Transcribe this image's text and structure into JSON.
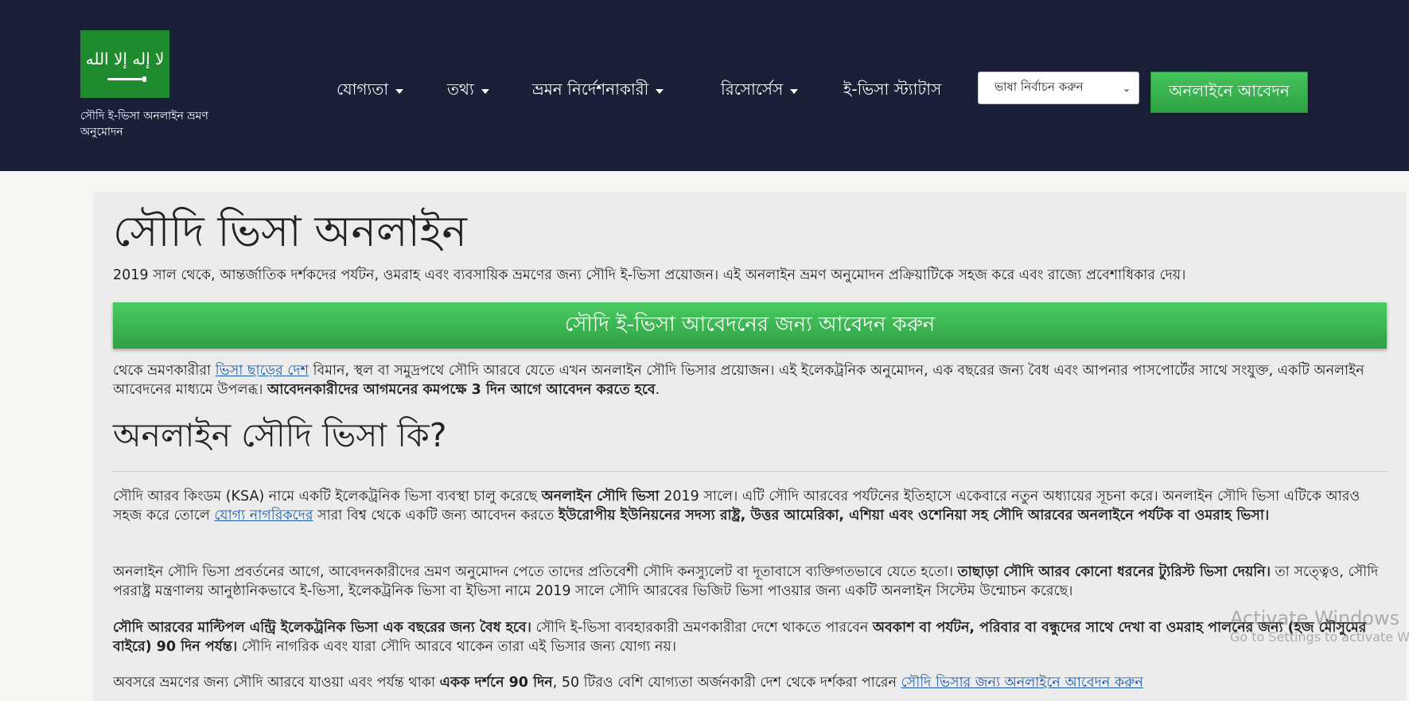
{
  "header": {
    "logo_caption": "সৌদি ই-ভিসা অনলাইন ভ্রমণ অনুমোদন",
    "flag_script": "لا إله إلا الله"
  },
  "nav": {
    "items": [
      {
        "label": "যোগ্যতা"
      },
      {
        "label": "তথ্য"
      },
      {
        "label": "ভ্রমন নির্দেশনাকারী"
      },
      {
        "label": "রিসোর্সেস"
      },
      {
        "label": "ই-ভিসা স্ট্যাটাস"
      }
    ],
    "language_select": "ভাষা নির্বাচন করুন",
    "apply_button": "অনলাইনে আবেদন"
  },
  "main": {
    "title": "সৌদি ভিসা অনলাইন",
    "intro": "2019 সাল থেকে, আন্তর্জাতিক দর্শকদের পর্যটন, ওমরাহ এবং ব্যবসায়িক ভ্রমণের জন্য সৌদি ই-ভিসা প্রয়োজন। এই অনলাইন ভ্রমণ অনুমোদন প্রক্রিয়াটিকে সহজ করে এবং রাজ্যে প্রবেশাধিকার দেয়।",
    "apply_big_button": "সৌদি ই-ভিসা আবেদনের জন্য আবেদন করুন",
    "p2": {
      "t1": "থেকে ভ্রমণকারীরা ",
      "link": "ভিসা ছাড়ের দেশ",
      "t2": " বিমান, স্থল বা সমুদ্রপথে সৌদি আরবে যেতে এখন অনলাইন সৌদি ভিসার প্রয়োজন। এই ইলেকট্রনিক অনুমোদন, এক বছরের জন্য বৈধ এবং আপনার পাসপোর্টের সাথে সংযুক্ত, একটি অনলাইন আবেদনের মাধ্যমে উপলব্ধ। ",
      "bold": "আবেদনকারীদের আগমনের কমপক্ষে 3 দিন আগে আবেদন করতে হবে",
      "t3": "."
    },
    "subtitle": "অনলাইন সৌদি ভিসা কি?",
    "p3": {
      "t1": "সৌদি আরব কিংডম (KSA) নামে একটি ইলেকট্রনিক ভিসা ব্যবস্থা চালু করেছে ",
      "b1": "অনলাইন সৌদি ভিসা",
      "t2": " 2019 সালে। এটি সৌদি আরবের পর্যটনের ইতিহাসে একেবারে নতুন অধ্যায়ের সূচনা করে। অনলাইন সৌদি ভিসা এটিকে আরও সহজ করে তোলে ",
      "link": "যোগ্য নাগরিকদের",
      "t3": " সারা বিশ্ব থেকে একটি জন্য আবেদন করতে ",
      "b2": "ইউরোপীয় ইউনিয়নের সদস্য রাষ্ট্র, উত্তর আমেরিকা, এশিয়া এবং ওশেনিয়া সহ সৌদি আরবের অনলাইনে পর্যটক বা ওমরাহ ভিসা।"
    },
    "p4": {
      "t1": "অনলাইন সৌদি ভিসা প্রবর্তনের আগে, আবেদনকারীদের ভ্রমণ অনুমোদন পেতে তাদের প্রতিবেশী সৌদি কনস্যুলেট বা দূতাবাসে ব্যক্তিগতভাবে যেতে হতো। ",
      "b1": "তাছাড়া সৌদি আরব কোনো ধরনের ট্যুরিস্ট ভিসা দেয়নি।",
      "t2": " তা সত্ত্বেও, সৌদি পররাষ্ট্র মন্ত্রণালয় আনুষ্ঠানিকভাবে ই-ভিসা, ইলেকট্রনিক ভিসা বা ইভিসা নামে 2019 সালে সৌদি আরবের ভিজিট ভিসা পাওয়ার জন্য একটি অনলাইন সিস্টেম উন্মোচন করেছে।"
    },
    "p5": {
      "b1": "সৌদি আরবের মাল্টিপল এন্ট্রি ইলেকট্রনিক ভিসা এক বছরের জন্য বৈধ হবে।",
      "t1": " সৌদি ই-ভিসা ব্যবহারকারী ভ্রমণকারীরা দেশে থাকতে পারবেন ",
      "b2": "অবকাশ বা পর্যটন, পরিবার বা বন্ধুদের সাথে দেখা বা ওমরাহ পালনের জন্য (হজ মৌসুমের বাইরে) 90 দিন পর্যন্ত।",
      "t2": " সৌদি নাগরিক এবং যারা সৌদি আরবে থাকেন তারা এই ভিসার জন্য যোগ্য নয়।"
    },
    "p6": {
      "t1": "অবসরে ভ্রমণের জন্য সৌদি আরবে যাওয়া এবং পর্যন্ত থাকা ",
      "b1": "একক দর্শনে 90 দিন",
      "t2": ", 50 টিরও বেশি যোগ্যতা অর্জনকারী দেশ থেকে দর্শকরা পারেন ",
      "link": "সৌদি ভিসার জন্য অনলাইনে আবেদন করুন"
    }
  },
  "os_watermark": {
    "line1": "Activate Windows",
    "line2": "Go to Settings to activate W"
  }
}
